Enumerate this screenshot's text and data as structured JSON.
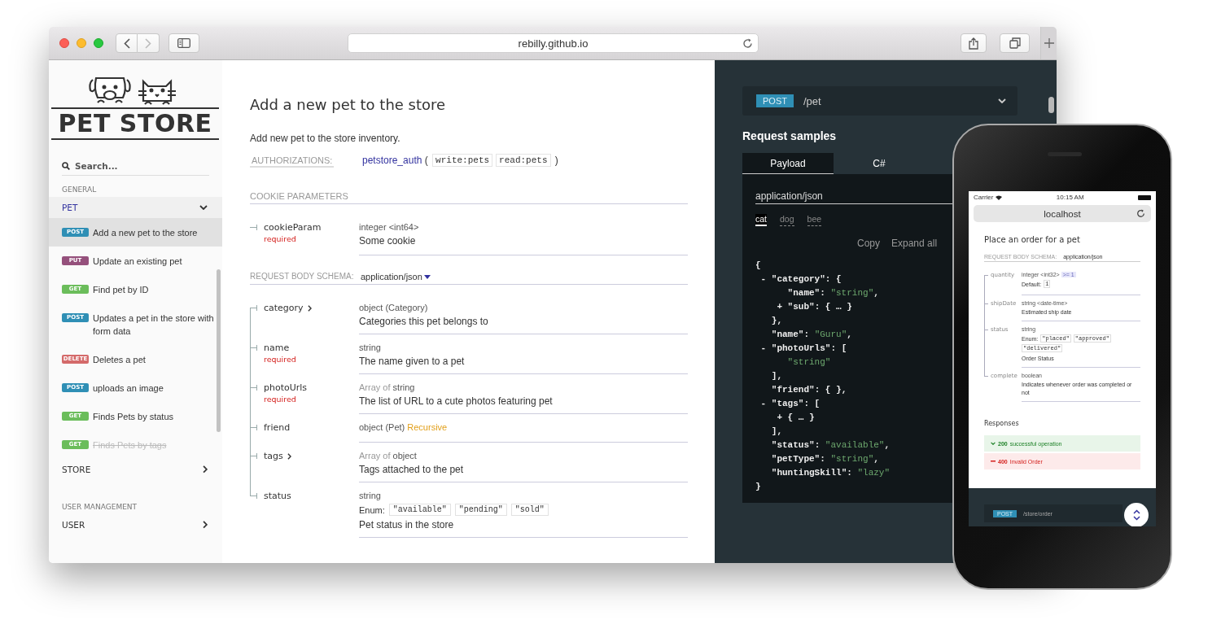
{
  "browser": {
    "url": "rebilly.github.io",
    "forward_disabled": true
  },
  "sidebar": {
    "logo": "PET STORE",
    "search_placeholder": "Search...",
    "groups": [
      {
        "heading": "GENERAL",
        "items": [
          {
            "label": "PET",
            "expanded": true,
            "children": [
              {
                "method": "POST",
                "color": "#2f8fb5",
                "label": "Add a new pet to the store",
                "selected": true,
                "deprecated": false
              },
              {
                "method": "PUT",
                "color": "#95507c",
                "label": "Update an existing pet",
                "selected": false,
                "deprecated": false
              },
              {
                "method": "GET",
                "color": "#6bbd5b",
                "label": "Find pet by ID",
                "selected": false,
                "deprecated": false
              },
              {
                "method": "POST",
                "color": "#2f8fb5",
                "label": "Updates a pet in the store with form data",
                "selected": false,
                "deprecated": false
              },
              {
                "method": "DELETE",
                "color": "#d46a6a",
                "label": "Deletes a pet",
                "selected": false,
                "deprecated": false
              },
              {
                "method": "POST",
                "color": "#2f8fb5",
                "label": "uploads an image",
                "selected": false,
                "deprecated": false
              },
              {
                "method": "GET",
                "color": "#6bbd5b",
                "label": "Finds Pets by status",
                "selected": false,
                "deprecated": false
              },
              {
                "method": "GET",
                "color": "#6bbd5b",
                "label": "Finds Pets by tags",
                "selected": false,
                "deprecated": true
              }
            ]
          },
          {
            "label": "STORE",
            "expanded": false
          }
        ]
      },
      {
        "heading": "USER MANAGEMENT",
        "items": [
          {
            "label": "USER",
            "expanded": false
          }
        ]
      }
    ]
  },
  "operation": {
    "title": "Add a new pet to the store",
    "description": "Add new pet to the store inventory.",
    "auth": {
      "label": "AUTHORIZATIONS:",
      "scheme": "petstore_auth",
      "open": "(",
      "scopes": [
        "write:pets",
        "read:pets"
      ],
      "close": ")"
    },
    "cookie_section": {
      "heading": "COOKIE PARAMETERS",
      "params": [
        {
          "name": "cookieParam",
          "expandable": false,
          "required": "required",
          "type": "integer <int64>",
          "description": "Some cookie"
        }
      ]
    },
    "body": {
      "label": "REQUEST BODY SCHEMA:",
      "content_type": "application/json",
      "fields": [
        {
          "name": "category",
          "expandable": true,
          "type": "object (Category)",
          "description": "Categories this pet belongs to"
        },
        {
          "name": "name",
          "expandable": false,
          "required": "required",
          "type": "string",
          "description": "The name given to a pet"
        },
        {
          "name": "photoUrls",
          "expandable": false,
          "required": "required",
          "type_prefix": "Array of",
          "type": "string",
          "description": "The list of URL to a cute photos featuring pet"
        },
        {
          "name": "friend",
          "expandable": false,
          "type": "object (Pet)",
          "badge": "Recursive"
        },
        {
          "name": "tags",
          "expandable": true,
          "type_prefix": "Array of",
          "type": "object",
          "description": "Tags attached to the pet"
        },
        {
          "name": "status",
          "expandable": false,
          "type": "string",
          "enum_label": "Enum:",
          "enum": [
            "\"available\"",
            "\"pending\"",
            "\"sold\""
          ],
          "description": "Pet status in the store"
        }
      ]
    }
  },
  "samples": {
    "method": "POST",
    "path": "/pet",
    "heading": "Request samples",
    "tabs": [
      {
        "label": "Payload",
        "selected": true
      },
      {
        "label": "C#",
        "selected": false
      }
    ],
    "content_type": "application/json",
    "examples": [
      {
        "label": "cat",
        "selected": true
      },
      {
        "label": "dog",
        "selected": false
      },
      {
        "label": "bee",
        "selected": false
      }
    ],
    "actions": [
      "Copy",
      "Expand all"
    ],
    "code": [
      "{",
      " - \"category\": {",
      "      \"name\": \"string\",",
      "    + \"sub\": { … }",
      "   },",
      "   \"name\": \"Guru\",",
      " - \"photoUrls\": [",
      "      \"string\"",
      "   ],",
      "   \"friend\": { },",
      " - \"tags\": [",
      "    + { … }",
      "   ],",
      "   \"status\": \"available\",",
      "   \"petType\": \"string\",",
      "   \"huntingSkill\": \"lazy\"",
      "}"
    ]
  },
  "phone": {
    "carrier": "Carrier",
    "time": "10:15 AM",
    "url": "localhost",
    "title": "Place an order for a pet",
    "schema_label": "REQUEST BODY SCHEMA:",
    "content_type": "application/json",
    "fields": [
      {
        "name": "quantity",
        "type": "integer <int32>",
        "constraint": ">= 1",
        "default_label": "Default:",
        "default": "1"
      },
      {
        "name": "shipDate",
        "type": "string <date-time>",
        "description": "Estimated ship date"
      },
      {
        "name": "status",
        "type": "string",
        "enum_label": "Enum:",
        "enum": [
          "\"placed\"",
          "\"approved\"",
          "\"delivered\""
        ],
        "description": "Order Status"
      },
      {
        "name": "complete",
        "type": "boolean",
        "description": "Indicates whenever order was completed or not"
      }
    ],
    "responses_heading": "Responses",
    "responses": [
      {
        "kind": "success",
        "code": "200",
        "text": "successful operation"
      },
      {
        "kind": "error",
        "code": "400",
        "text": "Invalid Order"
      }
    ],
    "method": "POST",
    "path": "/store/order"
  }
}
